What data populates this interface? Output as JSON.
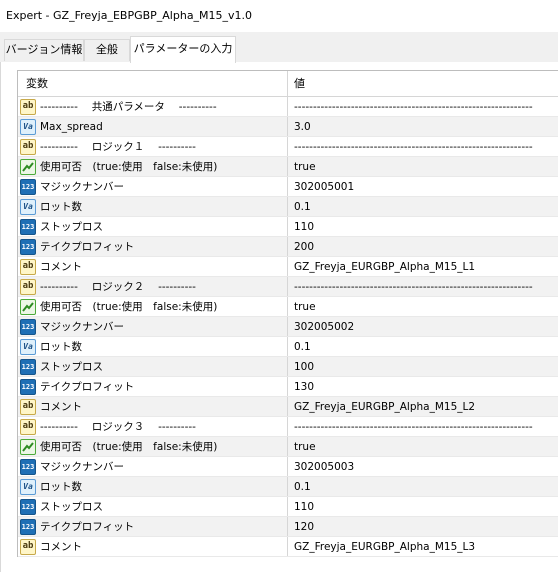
{
  "window": {
    "title": "Expert - GZ_Freyja_EBPGBP_Alpha_M15_v1.0"
  },
  "tabs": [
    {
      "label": "バージョン情報",
      "active": false
    },
    {
      "label": "全般",
      "active": false
    },
    {
      "label": "パラメーターの入力",
      "active": true
    }
  ],
  "grid": {
    "columns": {
      "name": "変数",
      "value": "値"
    },
    "rows": [
      {
        "icon": "ab",
        "name": "---------- 　共通パラメータ　 ----------",
        "value": "---------------------------------------------------------------"
      },
      {
        "icon": "va",
        "name": "Max_spread",
        "value": "3.0"
      },
      {
        "icon": "ab",
        "name": "---------- 　ロジック１ 　----------",
        "value": "---------------------------------------------------------------"
      },
      {
        "icon": "bool",
        "name": "使用可否　(true:使用　false:未使用)",
        "value": "true"
      },
      {
        "icon": "123",
        "name": "マジックナンバー",
        "value": "302005001"
      },
      {
        "icon": "va",
        "name": "ロット数",
        "value": "0.1"
      },
      {
        "icon": "123",
        "name": "ストップロス",
        "value": "110"
      },
      {
        "icon": "123",
        "name": "テイクプロフィット",
        "value": "200"
      },
      {
        "icon": "ab",
        "name": "コメント",
        "value": "GZ_Freyja_EURGBP_Alpha_M15_L1"
      },
      {
        "icon": "ab",
        "name": "---------- 　ロジック２ 　----------",
        "value": "---------------------------------------------------------------"
      },
      {
        "icon": "bool",
        "name": "使用可否　(true:使用　false:未使用)",
        "value": "true"
      },
      {
        "icon": "123",
        "name": "マジックナンバー",
        "value": "302005002"
      },
      {
        "icon": "va",
        "name": "ロット数",
        "value": "0.1"
      },
      {
        "icon": "123",
        "name": "ストップロス",
        "value": "100"
      },
      {
        "icon": "123",
        "name": "テイクプロフィット",
        "value": "130"
      },
      {
        "icon": "ab",
        "name": "コメント",
        "value": "GZ_Freyja_EURGBP_Alpha_M15_L2"
      },
      {
        "icon": "ab",
        "name": "---------- 　ロジック３ 　----------",
        "value": "---------------------------------------------------------------"
      },
      {
        "icon": "bool",
        "name": "使用可否　(true:使用　false:未使用)",
        "value": "true"
      },
      {
        "icon": "123",
        "name": "マジックナンバー",
        "value": "302005003"
      },
      {
        "icon": "va",
        "name": "ロット数",
        "value": "0.1"
      },
      {
        "icon": "123",
        "name": "ストップロス",
        "value": "110"
      },
      {
        "icon": "123",
        "name": "テイクプロフィット",
        "value": "120"
      },
      {
        "icon": "ab",
        "name": "コメント",
        "value": "GZ_Freyja_EURGBP_Alpha_M15_L3"
      }
    ]
  },
  "icon_labels": {
    "ab": "ab",
    "va": "Va",
    "123": "123"
  },
  "icon_names": {
    "ab": "string-type-icon",
    "va": "double-type-icon",
    "123": "integer-type-icon",
    "bool": "boolean-type-icon"
  },
  "colors": {
    "row_alt": "#f2f2f2",
    "grid_border": "#bdbdbd",
    "integer_icon": "#1f6fb5",
    "boolean_icon": "#4caa3a",
    "string_icon": "#fff6c8"
  }
}
